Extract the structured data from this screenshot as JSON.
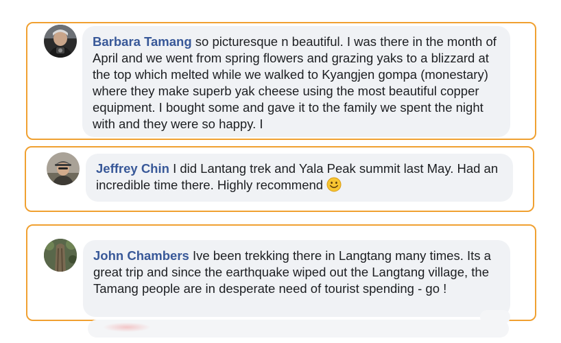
{
  "comments": [
    {
      "author": "Barbara Tamang",
      "text": "so picturesque n beautiful. I was there in the month of April and we went from spring flowers and grazing yaks to a blizzard at the top which melted while we walked to Kyangjen gompa (monestary) where they make superb yak cheese using the most beautiful copper equipment. I bought some and gave it to the family we spent the night with and they were so happy. I",
      "avatar_icon": "profile-photo-avatar"
    },
    {
      "author": "Jeffrey Chin",
      "text": "I did Lantang trek and Yala Peak summit last May. Had an incredible time there. Highly recommend",
      "emoji_icon": "smiley-emoji-icon",
      "avatar_icon": "profile-photo-avatar"
    },
    {
      "author": "John Chambers",
      "text": "Ive been trekking there in Langtang many times. Its a great trip and since the earthquake wiped out the Langtang village, the Tamang people are in desperate need of tourist spending - go !",
      "avatar_icon": "profile-photo-avatar"
    }
  ],
  "colors": {
    "highlight_border": "#f0a030",
    "author_name": "#385898",
    "bubble_background": "#f0f2f5",
    "body_text": "#1c1e21"
  }
}
